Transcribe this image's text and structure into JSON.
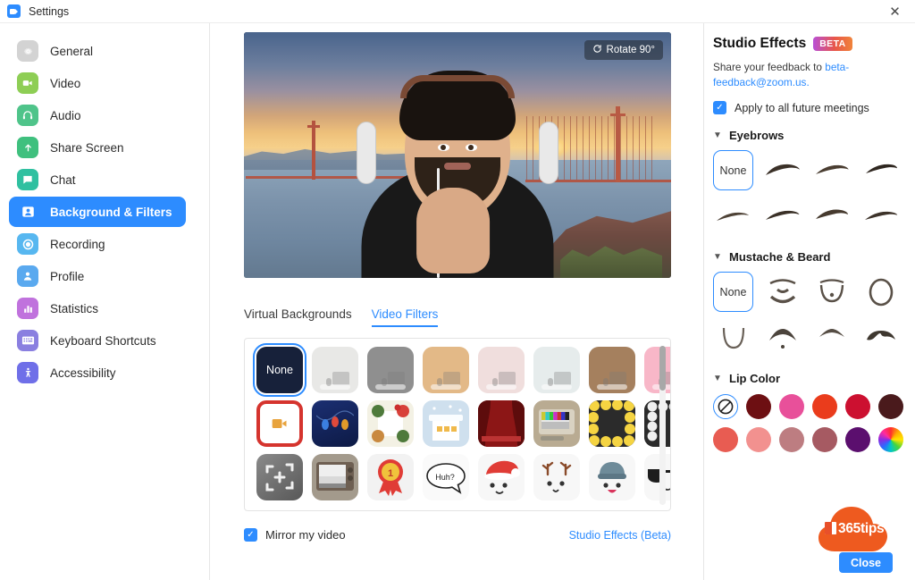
{
  "window": {
    "title": "Settings",
    "logo_icon": "zoom-camera-icon",
    "close_icon": "✕"
  },
  "sidebar": {
    "items": [
      {
        "label": "General",
        "icon": "gear-icon",
        "active": false
      },
      {
        "label": "Video",
        "icon": "camera-icon",
        "active": false
      },
      {
        "label": "Audio",
        "icon": "headset-icon",
        "active": false
      },
      {
        "label": "Share Screen",
        "icon": "upload-icon",
        "active": false
      },
      {
        "label": "Chat",
        "icon": "chat-bubble-icon",
        "active": false
      },
      {
        "label": "Background & Filters",
        "icon": "person-card-icon",
        "active": true
      },
      {
        "label": "Recording",
        "icon": "record-icon",
        "active": false
      },
      {
        "label": "Profile",
        "icon": "user-icon",
        "active": false
      },
      {
        "label": "Statistics",
        "icon": "bar-chart-icon",
        "active": false
      },
      {
        "label": "Keyboard Shortcuts",
        "icon": "keyboard-icon",
        "active": false
      },
      {
        "label": "Accessibility",
        "icon": "accessibility-icon",
        "active": false
      }
    ],
    "active_color": "#2D8CFF"
  },
  "preview": {
    "rotate_label": "Rotate 90°",
    "rotate_icon": "rotate-icon",
    "background_description": "Golden Gate Bridge sunset virtual background",
    "subject_description": "Person wearing headphones with hand on chin"
  },
  "tabs": [
    {
      "label": "Virtual Backgrounds",
      "active": false
    },
    {
      "label": "Video Filters",
      "active": true
    }
  ],
  "filters": {
    "rows": [
      [
        {
          "name": "None",
          "type": "none",
          "color": "#17213a"
        },
        {
          "name": "Ash",
          "type": "tint",
          "color": "#e8e8e6"
        },
        {
          "name": "Slate",
          "type": "tint",
          "color": "#8f8f8f"
        },
        {
          "name": "Sand",
          "type": "tint",
          "color": "#e3b987"
        },
        {
          "name": "Blush",
          "type": "tint",
          "color": "#f0dedd"
        },
        {
          "name": "Frost",
          "type": "tint",
          "color": "#e6ecec"
        },
        {
          "name": "Mocha",
          "type": "tint",
          "color": "#a5805e"
        },
        {
          "name": "Rose",
          "type": "tint",
          "color": "#f8b7c8"
        }
      ],
      [
        {
          "name": "Holiday Frame",
          "type": "art",
          "color": "#d5342e"
        },
        {
          "name": "String Lights",
          "type": "art",
          "color": "#1b2f72"
        },
        {
          "name": "Wreath",
          "type": "art",
          "color": "#f3f1e4"
        },
        {
          "name": "Snow House",
          "type": "art",
          "color": "#cfe0ee"
        },
        {
          "name": "Red Curtains",
          "type": "art",
          "color": "#8c1616"
        },
        {
          "name": "Retro TV",
          "type": "art",
          "color": "#b9ab92"
        },
        {
          "name": "Emoji Border",
          "type": "art",
          "color": "#f5d442"
        },
        {
          "name": "Pearl Frame",
          "type": "art",
          "color": "#2b2b2b"
        }
      ],
      [
        {
          "name": "Focus Frame",
          "type": "art",
          "color": "#6e6e6e"
        },
        {
          "name": "Vintage TV",
          "type": "art",
          "color": "#a39a8c"
        },
        {
          "name": "Number One",
          "type": "art",
          "color": "#f2f2f2"
        },
        {
          "name": "Huh Bubble",
          "type": "art",
          "color": "#fafafa"
        },
        {
          "name": "Santa Hat",
          "type": "art",
          "color": "#f7f7f7"
        },
        {
          "name": "Reindeer",
          "type": "art",
          "color": "#f7f7f7"
        },
        {
          "name": "Beanie",
          "type": "art",
          "color": "#f7f7f7"
        },
        {
          "name": "Sunglasses",
          "type": "art",
          "color": "#f7f7f7"
        }
      ]
    ],
    "selected": "None"
  },
  "bottom": {
    "mirror_label": "Mirror my video",
    "mirror_checked": true,
    "studio_effects_link": "Studio Effects (Beta)"
  },
  "studio": {
    "title": "Studio Effects",
    "badge": "BETA",
    "feedback_prefix": "Share your feedback to",
    "feedback_email": "beta-feedback@zoom.us.",
    "apply_label": "Apply to all future meetings",
    "apply_checked": true,
    "sections": [
      {
        "title": "Eyebrows",
        "expanded": true,
        "none_label": "None"
      },
      {
        "title": "Mustache & Beard",
        "expanded": true,
        "none_label": "None"
      },
      {
        "title": "Lip Color",
        "expanded": true
      }
    ],
    "lip_colors": [
      [
        "none",
        "#6d0f12",
        "#e8509a",
        "#ea3c1c",
        "#cc1030",
        "#4a1a1c"
      ],
      [
        "#e85c52",
        "#f2918f",
        "#bd7d81",
        "#a65a62",
        "#5b0f6e",
        "wheel"
      ]
    ]
  },
  "watermark": {
    "brand": "365tips",
    "close_label": "Close",
    "cloud_color": "#ee5a1f",
    "button_color": "#2D8CFF"
  }
}
